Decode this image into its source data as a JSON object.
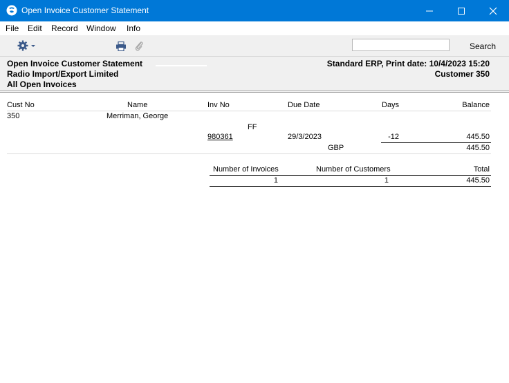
{
  "window": {
    "title": "Open Invoice Customer Statement"
  },
  "menu": [
    "File",
    "Edit",
    "Record",
    "Window",
    "Info"
  ],
  "toolbar": {
    "search_label": "Search",
    "search_value": ""
  },
  "report_header": {
    "title": "Open Invoice Customer Statement",
    "company": "Radio Import/Export Limited",
    "selection": "All Open Invoices",
    "print_info": "Standard ERP, Print date: 10/4/2023 15:20",
    "customer_range": "Customer 350"
  },
  "columns": {
    "cust_no": "Cust No",
    "name": "Name",
    "inv_no": "Inv No",
    "due_date": "Due Date",
    "days": "Days",
    "balance": "Balance"
  },
  "customer": {
    "cust_no": "350",
    "name": "Merriman, George",
    "group": "FF"
  },
  "invoice": {
    "inv_no": "980361",
    "due_date": "29/3/2023",
    "days": "-12",
    "balance": "445.50"
  },
  "currency": {
    "code": "GBP",
    "subtotal": "445.50"
  },
  "summary": {
    "invoices_label": "Number of Invoices",
    "customers_label": "Number of Customers",
    "total_label": "Total",
    "invoices": "1",
    "customers": "1",
    "total": "445.50"
  }
}
